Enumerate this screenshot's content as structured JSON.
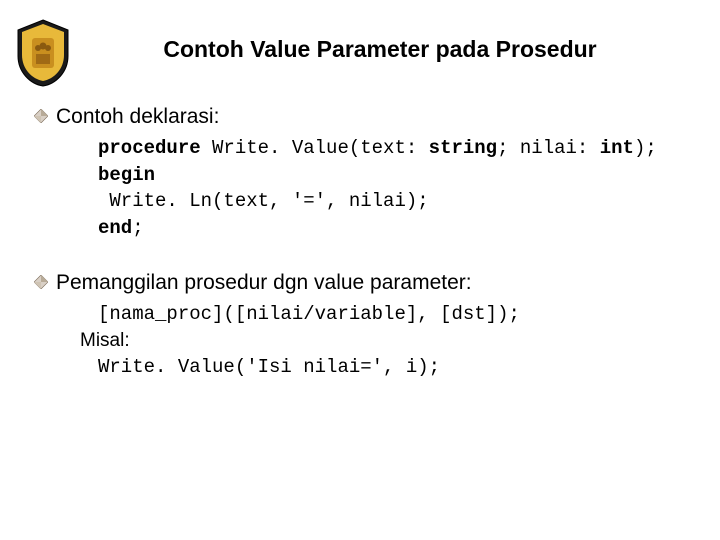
{
  "title": "Contoh Value Parameter pada Prosedur",
  "section1": {
    "heading": "Contoh deklarasi:",
    "code": {
      "l1_kw1": "procedure",
      "l1_mid": " Write. Value(text: ",
      "l1_kw2": "string",
      "l1_mid2": "; nilai: ",
      "l1_kw3": "int",
      "l1_end": ");",
      "l2_kw": "begin",
      "l3": " Write. Ln(text, '=', nilai);",
      "l4_kw": "end",
      "l4_end": ";"
    }
  },
  "section2": {
    "heading": "Pemanggilan prosedur dgn value parameter:",
    "syntax": "[nama_proc]([nilai/variable], [dst]);",
    "misal_label": "Misal:",
    "example": "Write. Value('Isi nilai=', i);"
  }
}
